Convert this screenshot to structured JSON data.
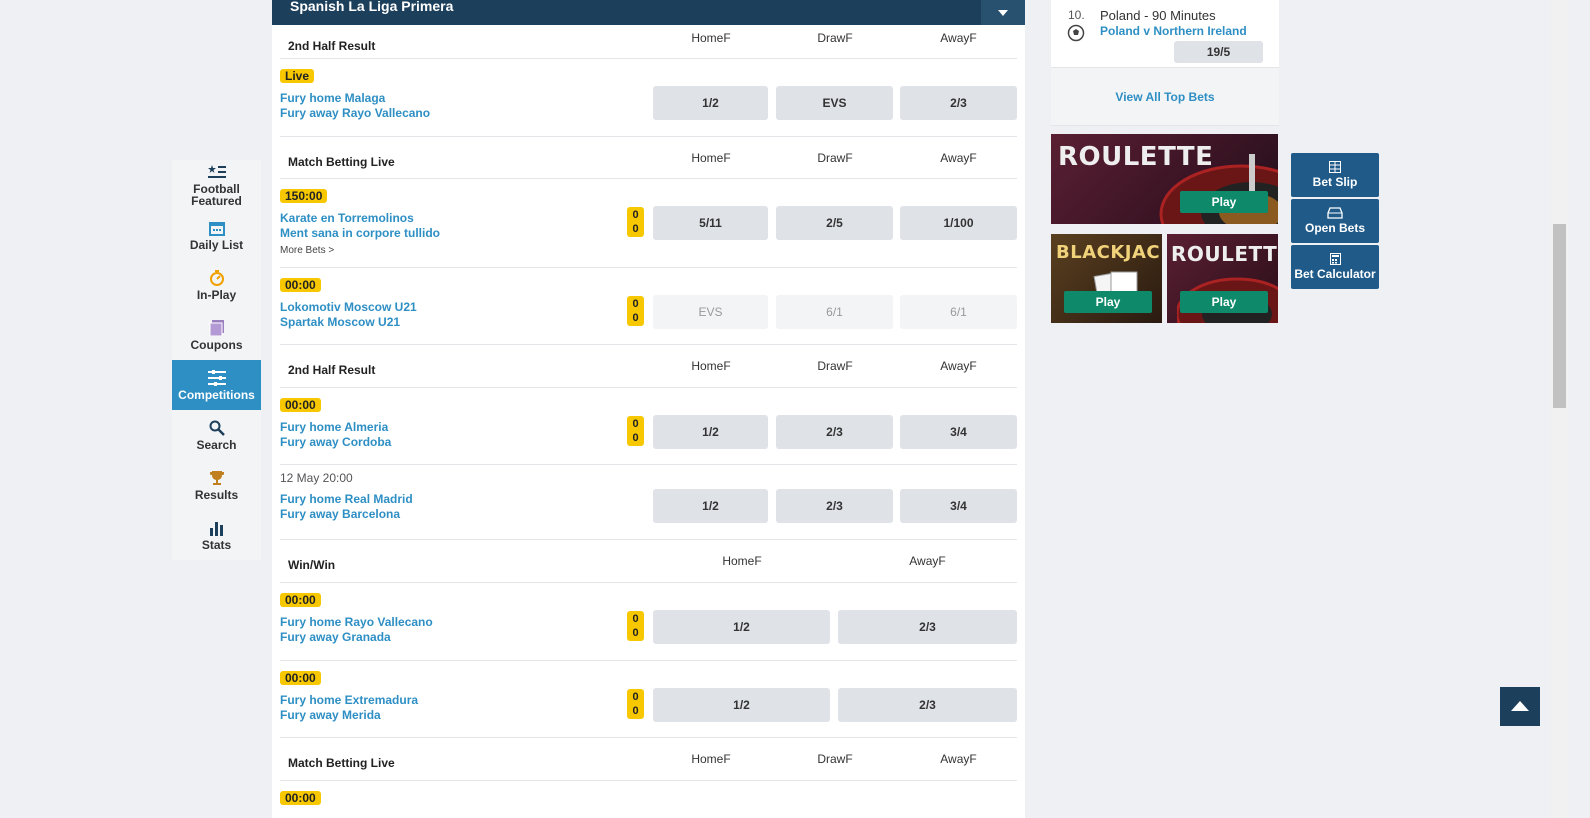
{
  "nav": [
    {
      "label": "Football Featured",
      "icon": "football-featured-icon"
    },
    {
      "label": "Daily List",
      "icon": "calendar-icon"
    },
    {
      "label": "In-Play",
      "icon": "stopwatch-icon"
    },
    {
      "label": "Coupons",
      "icon": "coupons-icon"
    },
    {
      "label": "Competitions",
      "icon": "competitions-icon",
      "active": true
    },
    {
      "label": "Search",
      "icon": "search-icon"
    },
    {
      "label": "Results",
      "icon": "trophy-icon"
    },
    {
      "label": "Stats",
      "icon": "stats-icon"
    }
  ],
  "league": {
    "title": "Spanish La Liga Primera"
  },
  "markets": [
    {
      "title": "2nd Half Result",
      "cols": [
        "HomeF",
        "DrawF",
        "AwayF"
      ]
    },
    {
      "title": "Match Betting Live",
      "cols": [
        "HomeF",
        "DrawF",
        "AwayF"
      ]
    },
    {
      "title": "2nd Half Result",
      "cols": [
        "HomeF",
        "DrawF",
        "AwayF"
      ]
    },
    {
      "title": "Win/Win",
      "cols": [
        "HomeF",
        "AwayF"
      ]
    },
    {
      "title": "Match Betting Live",
      "cols": [
        "HomeF",
        "DrawF",
        "AwayF"
      ]
    }
  ],
  "events": [
    {
      "badge": "Live",
      "home": "Fury home Malaga",
      "away": "Fury away Rayo Vallecano",
      "odds": [
        "1/2",
        "EVS",
        "2/3"
      ]
    },
    {
      "badge": "150:00",
      "home": "Karate en Torremolinos",
      "away": "Ment sana in corpore tullido",
      "score": [
        "0",
        "0"
      ],
      "more": "More Bets >",
      "odds": [
        "5/11",
        "2/5",
        "1/100"
      ]
    },
    {
      "badge": "00:00",
      "home": "Lokomotiv Moscow U21",
      "away": "Spartak Moscow U21",
      "score": [
        "0",
        "0"
      ],
      "odds": [
        "EVS",
        "6/1",
        "6/1"
      ]
    },
    {
      "badge": "00:00",
      "home": "Fury home Almeria",
      "away": "Fury away Cordoba",
      "score": [
        "0",
        "0"
      ],
      "odds": [
        "1/2",
        "2/3",
        "3/4"
      ]
    },
    {
      "date": "12 May 20:00",
      "home": "Fury home Real Madrid",
      "away": "Fury away Barcelona",
      "odds": [
        "1/2",
        "2/3",
        "3/4"
      ]
    },
    {
      "badge": "00:00",
      "home": "Fury home Rayo Vallecano",
      "away": "Fury away Granada",
      "score": [
        "0",
        "0"
      ],
      "odds": [
        "1/2",
        "2/3"
      ]
    },
    {
      "badge": "00:00",
      "home": "Fury home Extremadura",
      "away": "Fury away Merida",
      "score": [
        "0",
        "0"
      ],
      "odds": [
        "1/2",
        "2/3"
      ]
    },
    {
      "badge": "00:00"
    }
  ],
  "topbet": {
    "rank": "10.",
    "market": "Poland - 90 Minutes",
    "event": "Poland v Northern Ireland",
    "odds": "19/5"
  },
  "view_all": "View All Top Bets",
  "promos": [
    {
      "word": "ROULETTE",
      "play": "Play"
    },
    {
      "word": "BLACKJAC",
      "play": "Play"
    },
    {
      "word": "ROULETTE",
      "play": "Play"
    }
  ],
  "betslip": [
    {
      "label": "Bet Slip",
      "icon": "bet-slip-icon"
    },
    {
      "label": "Open Bets",
      "icon": "open-bets-icon"
    },
    {
      "label": "Bet Calculator",
      "icon": "calculator-icon"
    }
  ]
}
